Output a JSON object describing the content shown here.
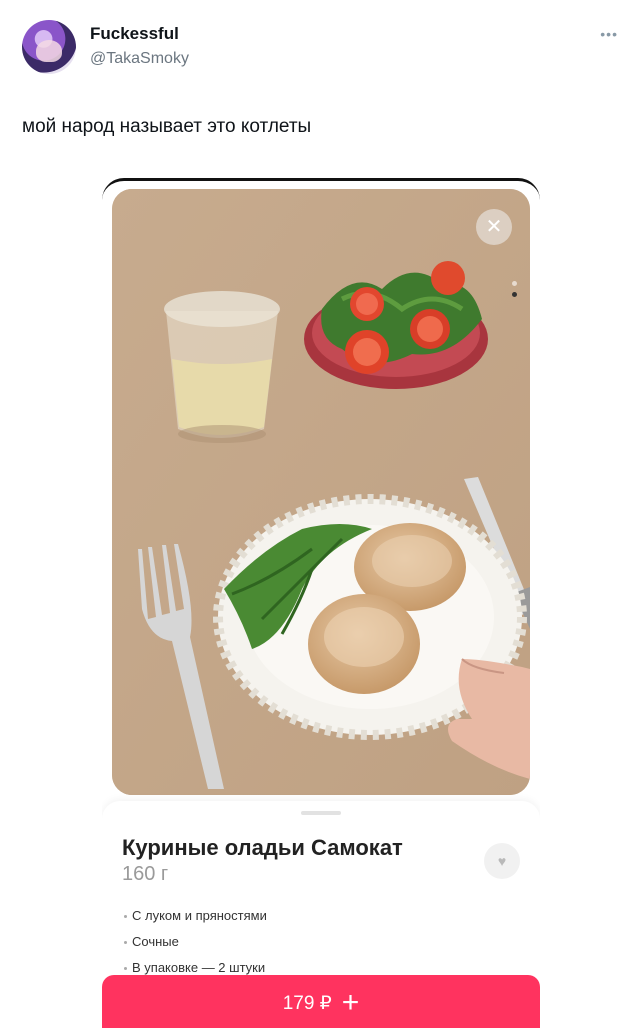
{
  "tweet": {
    "display_name": "Fuckessful",
    "handle": "@TakaSmoky",
    "more_icon": "•••",
    "text": "мой народ называет это котлеты"
  },
  "product_card": {
    "close_icon": "✕",
    "title": "Куриные оладьи Самокат",
    "weight": "160 г",
    "favorite_icon": "♥",
    "features": [
      "С луком и пряностями",
      "Сочные",
      "В упаковке — 2 штуки"
    ],
    "price": "179 ₽",
    "add_icon": "+"
  }
}
